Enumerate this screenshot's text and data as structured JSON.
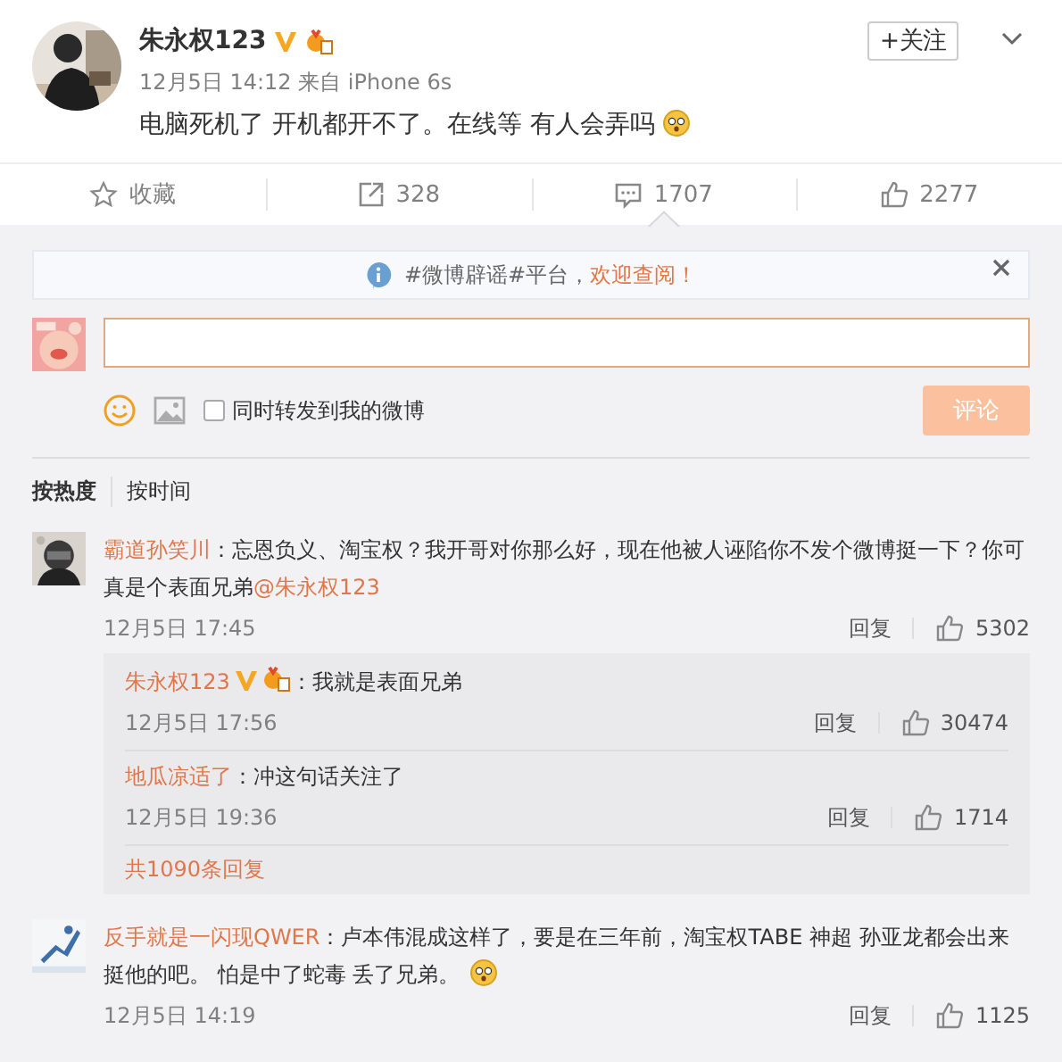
{
  "post": {
    "author": "朱永权123",
    "verified": true,
    "time": "12月5日 14:12 来自 iPhone 6s",
    "text": "电脑死机了 开机都开不了。在线等 有人会弄吗",
    "follow": "+关注"
  },
  "actions": [
    {
      "kind": "favorite",
      "label": "收藏",
      "selected": false
    },
    {
      "kind": "repost",
      "label": "328",
      "selected": false
    },
    {
      "kind": "comment",
      "label": "1707",
      "selected": true
    },
    {
      "kind": "like",
      "label": "2277",
      "selected": false
    }
  ],
  "notice": {
    "text": "#微博辟谣#平台，",
    "link": "欢迎查阅！"
  },
  "composer": {
    "repost_option": "同时转发到我的微博",
    "checked": false,
    "submit": "评论"
  },
  "sort_tabs": [
    {
      "label": "按热度",
      "selected": true
    },
    {
      "label": "按时间",
      "selected": false
    }
  ],
  "comments": [
    {
      "user": "霸道孙笑川",
      "verified": false,
      "text": "：忘恩负义、淘宝权？我开哥对你那么好，现在他被人诬陷你不发个微博挺一下？你可真是个表面兄弟",
      "mention": "@朱永权123",
      "emoji": false,
      "time": "12月5日 17:45",
      "reply": "回复",
      "likes": "5302",
      "replies": [
        {
          "user": "朱永权123",
          "verified": true,
          "text": "：我就是表面兄弟",
          "time": "12月5日 17:56",
          "reply": "回复",
          "likes": "30474"
        },
        {
          "user": "地瓜凉适了",
          "verified": false,
          "text": "：冲这句话关注了",
          "time": "12月5日 19:36",
          "reply": "回复",
          "likes": "1714"
        }
      ],
      "more": "共1090条回复"
    },
    {
      "user": "反手就是一闪现QWER",
      "verified": false,
      "text": "：卢本伟混成这样了，要是在三年前，淘宝权TABE 神超  孙亚龙都会出来挺他的吧。  怕是中了蛇毒 丢了兄弟。",
      "emoji": true,
      "time": "12月5日 14:19",
      "reply": "回复",
      "likes": "1125"
    }
  ]
}
